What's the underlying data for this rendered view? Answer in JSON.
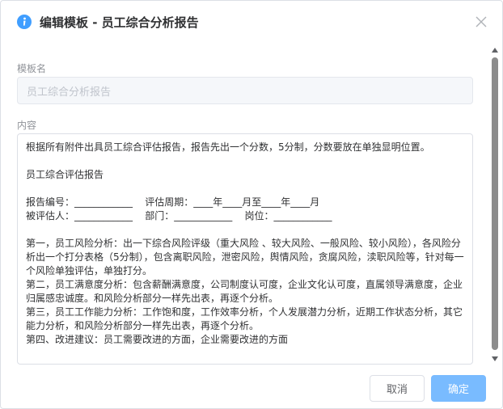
{
  "dialog": {
    "title": "编辑模板 - 员工综合分析报告",
    "info_icon": "info-circle-icon",
    "close_icon": "close-icon",
    "accent_color": "#409eff"
  },
  "form": {
    "name_label": "模板名",
    "name_value": "员工综合分析报告",
    "content_label": "内容",
    "content_value": "根据所有附件出具员工综合评估报告，报告先出一个分数，5分制，分数要放在单独显明位置。\n\n员工综合评估报告\n\n报告编号：____________    评估周期：____年____月至____年____月\n被评估人：____________    部门：____________    岗位：____________\n\n第一，员工风险分析：出一下综合风险评级（重大风险 、较大风险、一般风险、较小风险），各风险分析出一个打分表格（5分制），包含离职风险，泄密风险，舆情风险，贪腐风险，渎职风险等，针对每一个风险单独评估，单独打分。\n第二，员工满意度分析：包含薪酬满意度，公司制度认可度，企业文化认可度，直属领导满意度，企业归属感忠诚度。和风险分析部分一样先出表，再逐个分析。\n第三，员工工作能力分析：工作饱和度，工作效率分析，个人发展潜力分析，近期工作状态分析，其它能力分析，和风险分析部分一样先出表，再逐个分析。\n第四、改进建议：员工需要改进的方面，企业需要改进的方面"
  },
  "footer": {
    "cancel_label": "取消",
    "confirm_label": "确定"
  }
}
